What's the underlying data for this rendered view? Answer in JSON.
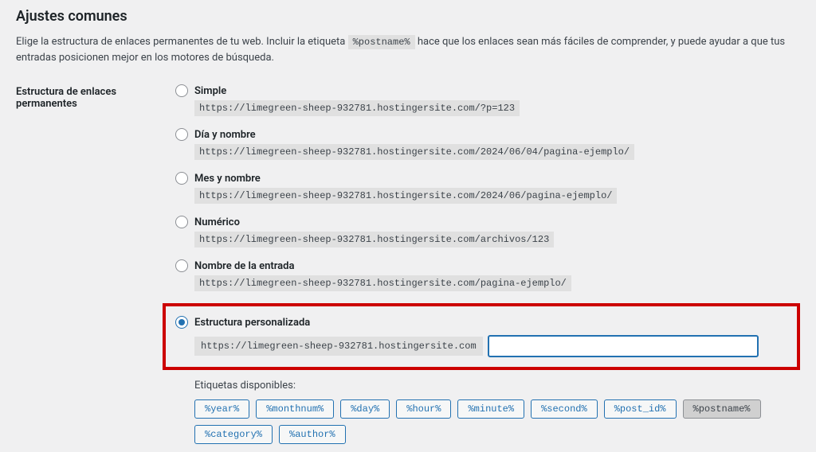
{
  "heading": "Ajustes comunes",
  "description_pre": "Elige la estructura de enlaces permanentes de tu web. Incluir la etiqueta ",
  "description_code": "%postname%",
  "description_post": " hace que los enlaces sean más fáciles de comprender, y puede ayudar a que tus entradas posicionen mejor en los motores de búsqueda.",
  "section_label": "Estructura de enlaces permanentes",
  "options": {
    "simple": {
      "label": "Simple",
      "example": "https://limegreen-sheep-932781.hostingersite.com/?p=123"
    },
    "day_name": {
      "label": "Día y nombre",
      "example": "https://limegreen-sheep-932781.hostingersite.com/2024/06/04/pagina-ejemplo/"
    },
    "month_name": {
      "label": "Mes y nombre",
      "example": "https://limegreen-sheep-932781.hostingersite.com/2024/06/pagina-ejemplo/"
    },
    "numeric": {
      "label": "Numérico",
      "example": "https://limegreen-sheep-932781.hostingersite.com/archivos/123"
    },
    "post_name": {
      "label": "Nombre de la entrada",
      "example": "https://limegreen-sheep-932781.hostingersite.com/pagina-ejemplo/"
    },
    "custom": {
      "label": "Estructura personalizada",
      "prefix": "https://limegreen-sheep-932781.hostingersite.com",
      "value": ""
    }
  },
  "available_tags_label": "Etiquetas disponibles:",
  "tags": [
    "%year%",
    "%monthnum%",
    "%day%",
    "%hour%",
    "%minute%",
    "%second%",
    "%post_id%",
    "%postname%",
    "%category%",
    "%author%"
  ],
  "active_tag": "%postname%"
}
